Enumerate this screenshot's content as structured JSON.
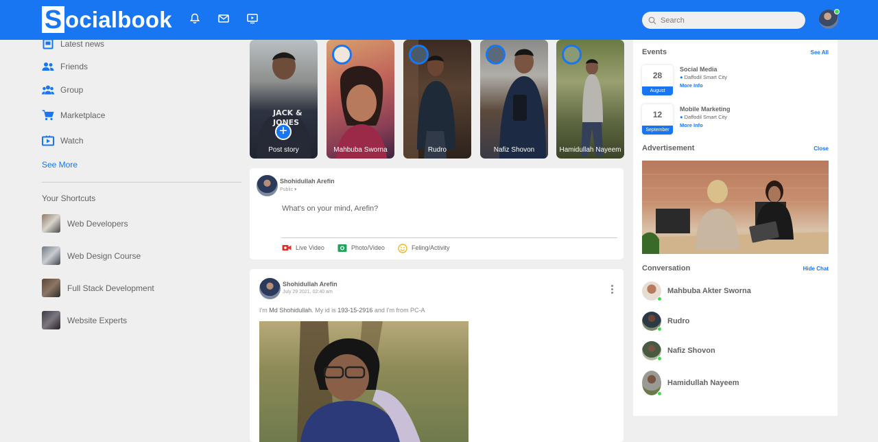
{
  "header": {
    "logo_letter": "S",
    "logo_rest": "ocialbook",
    "search_placeholder": "Search",
    "brand_color": "#1876f2"
  },
  "sidebar": {
    "items": [
      {
        "label": "Latest news",
        "icon": "news-icon"
      },
      {
        "label": "Friends",
        "icon": "friends-icon"
      },
      {
        "label": "Group",
        "icon": "group-icon"
      },
      {
        "label": "Marketplace",
        "icon": "cart-icon"
      },
      {
        "label": "Watch",
        "icon": "watch-icon"
      }
    ],
    "see_more": "See More",
    "shortcuts_title": "Your Shortcuts",
    "shortcuts": [
      {
        "label": "Web Developers"
      },
      {
        "label": "Web Design Course"
      },
      {
        "label": "Full Stack Development"
      },
      {
        "label": "Website Experts"
      }
    ]
  },
  "stories": [
    {
      "name": "Post story"
    },
    {
      "name": "Mahbuba Sworna"
    },
    {
      "name": "Rudro"
    },
    {
      "name": "Nafiz Shovon"
    },
    {
      "name": "Hamidullah Nayeem"
    }
  ],
  "create_post": {
    "user": "Shohidullah Arefin",
    "privacy": "Public",
    "placeholder": "What's on your mind, Arefin?",
    "actions": [
      {
        "label": "Live Video"
      },
      {
        "label": "Photo/Video"
      },
      {
        "label": "Feling/Activity"
      }
    ]
  },
  "post": {
    "user": "Shohidullah Arefin",
    "date": "July 29 2021, 02:40 am",
    "text_1": "I'm ",
    "text_name": "Md Shohidullah",
    "text_2": ". My id is ",
    "text_id": "193-15-2916",
    "text_3": " and I'm from PC-A"
  },
  "right": {
    "events_title": "Events",
    "events_link": "See All",
    "events": [
      {
        "day": "28",
        "month": "August",
        "title": "Social Media",
        "location": "Daffodil Smart City",
        "more": "More Info"
      },
      {
        "day": "12",
        "month": "September",
        "title": "Mobile Marketing",
        "location": "Daffodil Smart City",
        "more": "More Info"
      }
    ],
    "ad_title": "Advertisement",
    "ad_link": "Close",
    "conv_title": "Conversation",
    "conv_link": "Hide Chat",
    "conversations": [
      {
        "name": "Mahbuba Akter Sworna"
      },
      {
        "name": "Rudro"
      },
      {
        "name": "Nafiz Shovon"
      },
      {
        "name": "Hamidullah Nayeem"
      }
    ],
    "online_color": "#41db51"
  }
}
